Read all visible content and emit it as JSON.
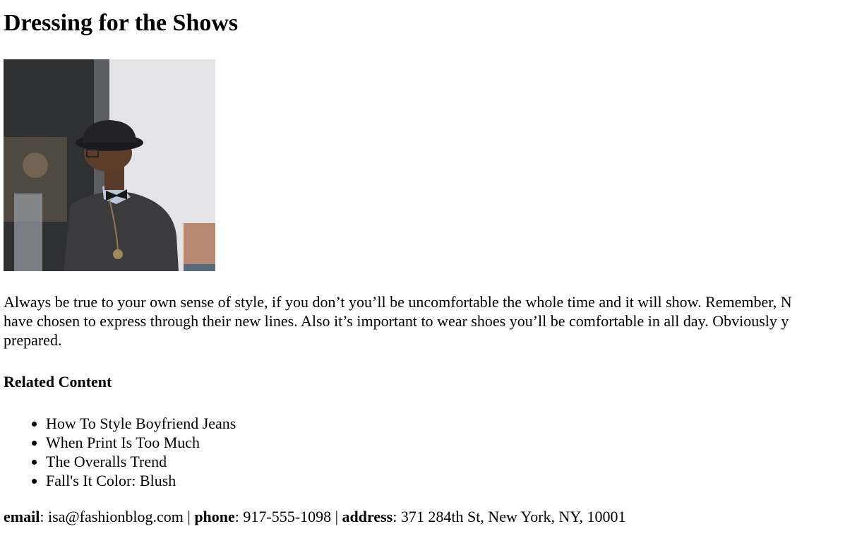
{
  "article": {
    "title": "Dressing for the Shows",
    "hero_image": "man-in-black-hat-and-bow-tie-photo",
    "body_lines": [
      "Always be true to your own sense of style, if you don’t you’ll be uncomfortable the whole time and it will show. Remember, N",
      "have chosen to express through their new lines. Also it’s important to wear shoes you’ll be comfortable in all day. Obviously y",
      "prepared."
    ]
  },
  "related": {
    "heading": "Related Content",
    "items": [
      "How To Style Boyfriend Jeans",
      "When Print Is Too Much",
      "The Overalls Trend",
      "Fall's It Color: Blush"
    ]
  },
  "contact": {
    "email_label": "email",
    "email_value": "isa@fashionblog.com",
    "phone_label": "phone",
    "phone_value": "917-555-1098",
    "address_label": "address",
    "address_value": "371 284th St, New York, NY, 10001",
    "separator": "|"
  }
}
